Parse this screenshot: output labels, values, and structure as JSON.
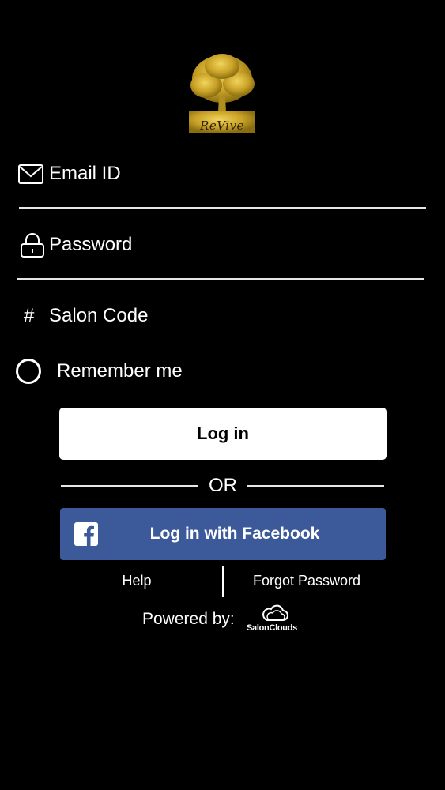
{
  "logo": {
    "brand_text": "ReVive",
    "primary_color": "#c9a227"
  },
  "form": {
    "email_label": "Email ID",
    "password_label": "Password",
    "salon_code_label": "Salon Code",
    "salon_code_symbol": "#",
    "remember_label": "Remember me",
    "remember_checked": false
  },
  "buttons": {
    "login_label": "Log in",
    "or_label": "OR",
    "facebook_label": "Log in with Facebook",
    "facebook_color": "#3c5a99"
  },
  "links": {
    "help_label": "Help",
    "forgot_label": "Forgot Password"
  },
  "footer": {
    "powered_label": "Powered by:",
    "provider_name": "SalonClouds"
  },
  "icons": {
    "email": "envelope-icon",
    "password": "lock-icon",
    "salon_code": "hash-icon",
    "facebook": "facebook-icon",
    "provider": "cloud-icon"
  }
}
